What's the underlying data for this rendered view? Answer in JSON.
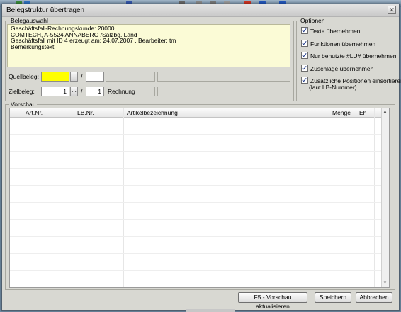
{
  "window": {
    "title": "Belegstruktur übertragen",
    "close_glyph": "✕"
  },
  "belegauswahl": {
    "legend": "Belegauswahl",
    "info_lines": [
      "Geschäftsfall-Rechnungskunde: 20000",
      "COMTECH, A-5524 ANNABERG /Salzbg. Land",
      "Geschäftsfall mit ID 4 erzeugt am: 24.07.2007 , Bearbeiter: tm",
      "Bemerkungstext:"
    ],
    "quellbeleg": {
      "label": "Quellbeleg:",
      "number": "",
      "sub": "",
      "type": ""
    },
    "zielbeleg": {
      "label": "Zielbeleg:",
      "number": "1",
      "sub": "1",
      "type": "Rechnung"
    },
    "browse_label": "...",
    "separator": "/"
  },
  "optionen": {
    "legend": "Optionen",
    "items": [
      {
        "label": "Texte übernehmen",
        "checked": true
      },
      {
        "label": "Funktionen übernehmen",
        "checked": true
      },
      {
        "label": "Nur benutzte #LU# übernehmen",
        "checked": true
      },
      {
        "label": "Zuschläge übernehmen",
        "checked": true
      },
      {
        "label": "Zusätzliche Positionen einsortieren",
        "checked": true
      }
    ],
    "last_note": "(laut LB-Nummer)"
  },
  "vorschau": {
    "legend": "Vorschau",
    "columns": [
      "Art.Nr.",
      "LB.Nr.",
      "Artikelbezeichnung",
      "Menge",
      "Eh"
    ],
    "rows": []
  },
  "buttons": {
    "refresh": "F5 - Vorschau aktualisieren",
    "save": "Speichern",
    "cancel": "Abbrechen"
  },
  "colors": {
    "highlight_field": "#ffff00",
    "info_background": "#fbfbd6",
    "dialog_background": "#d8d8d2"
  }
}
